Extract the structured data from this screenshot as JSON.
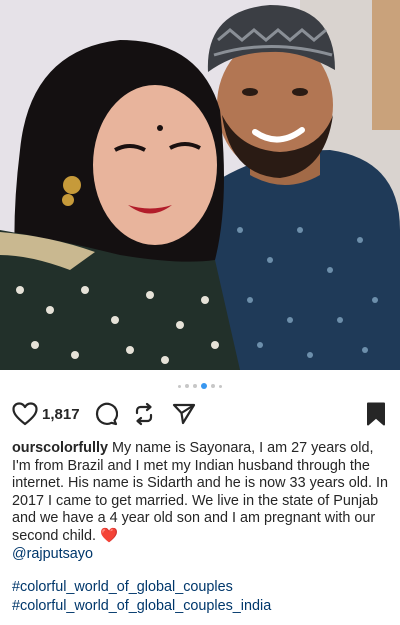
{
  "post": {
    "image": {
      "description_icon": "couple-photo"
    },
    "carousel": {
      "count": 6,
      "active_index": 3
    },
    "actions": {
      "like_icon": "heart-outline-icon",
      "like_count": "1,817",
      "comment_icon": "comment-bubble-icon",
      "repost_icon": "repost-arrows-icon",
      "share_icon": "paper-plane-icon",
      "save_icon": "bookmark-filled-icon"
    },
    "caption": {
      "username": "ourscolorfully",
      "text": " My name is Sayonara, I am 27 years old, I'm from Brazil and I met my Indian husband through the internet. His name is Sidarth and he is now 33 years old. In 2017 I came to get married. We live in the state of Punjab and we have a 4 year old son and I am pregnant with our second child. ",
      "emoji": "❤️",
      "mention": "@rajputsayo"
    },
    "hashtags": [
      "#colorful_world_of_global_couples",
      "#colorful_world_of_global_couples_india"
    ],
    "colors": {
      "link": "#00376b",
      "active_dot": "#3897f0",
      "text": "#262626"
    }
  }
}
